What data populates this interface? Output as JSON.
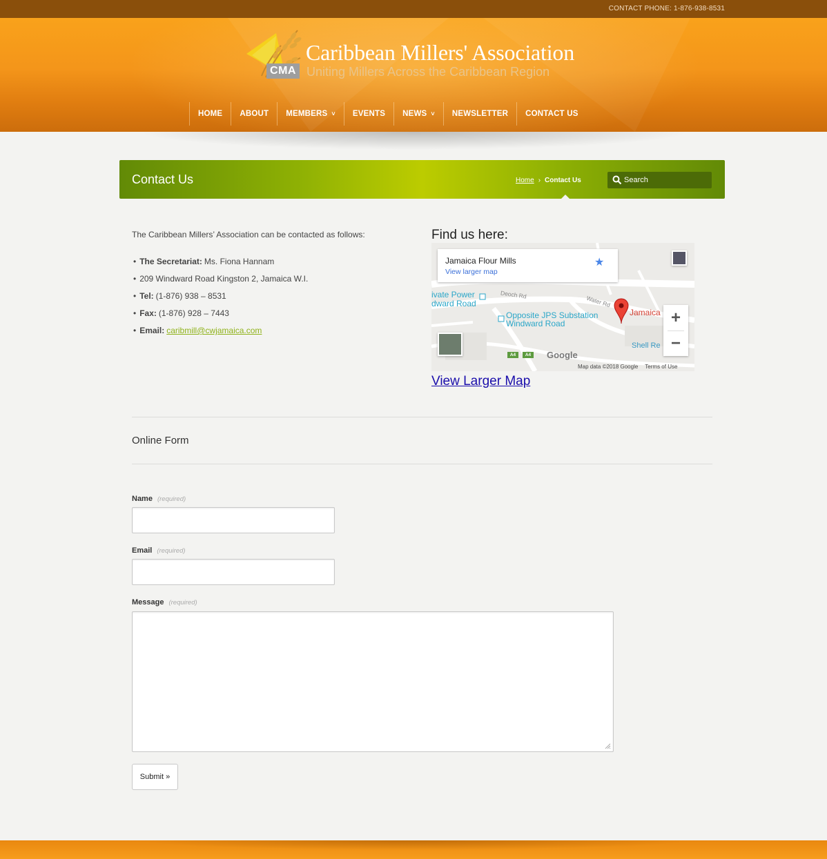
{
  "topbar": {
    "phone": "CONTACT PHONE: 1-876-938-8531"
  },
  "logo": {
    "abbr": "CMA",
    "name": "Caribbean Millers' Association",
    "tagline": "Uniting Millers Across the Caribbean Region"
  },
  "nav": {
    "items": [
      {
        "label": "HOME"
      },
      {
        "label": "ABOUT"
      },
      {
        "label": "MEMBERS",
        "chevron": "˅"
      },
      {
        "label": "EVENTS"
      },
      {
        "label": "NEWS",
        "chevron": "˅"
      },
      {
        "label": "NEWSLETTER"
      },
      {
        "label": "CONTACT US"
      }
    ]
  },
  "page": {
    "title": "Contact Us",
    "breadcrumb": {
      "home": "Home",
      "separator": "›",
      "current": "Contact Us"
    },
    "search_placeholder": "Search"
  },
  "contact": {
    "intro": "The Caribbean Millers’ Association can be contacted as follows:",
    "bullet": "•",
    "items": [
      {
        "label": "The Secretariat:",
        "value": "Ms. Fiona Hannam"
      },
      {
        "label": "",
        "value": "209 Windward Road Kingston 2, Jamaica W.I."
      },
      {
        "label": "Tel:",
        "value": "(1-876) 938 – 8531"
      },
      {
        "label": "Fax:",
        "value": "(1-876) 928 – 7443"
      },
      {
        "label": "Email:",
        "value": "caribmill@cwjamaica.com"
      }
    ]
  },
  "map": {
    "heading": "Find us here:",
    "place_name": "Jamaica Flour Mills",
    "view_larger_small": "View larger map",
    "star": "★",
    "labels": {
      "power": "ivate Power",
      "windward1": "dward Road",
      "deoch": "Deoch Rd",
      "water": "Water Rd",
      "jps1": "Opposite JPS Substation",
      "jps2": "Windward Road",
      "jamaica": "Jamaica",
      "shell": "Shell Re",
      "google": "Google",
      "a4": "A4",
      "mapdata": "Map data ©2018 Google",
      "terms": "Terms of Use"
    },
    "zoom_in": "+",
    "zoom_out": "−",
    "view_larger": "View Larger Map"
  },
  "form": {
    "title": "Online Form",
    "required": "(required)",
    "name_label": "Name",
    "name_value": "",
    "email_label": "Email",
    "email_value": "",
    "message_label": "Message",
    "message_value": "",
    "submit": "Submit »"
  },
  "colors": {
    "header_orange": "#f4951a",
    "topbar_brown": "#8a4f0b",
    "title_green": "#8fb104",
    "link_green": "#8fb21a",
    "link_blue": "#1a0dab"
  }
}
